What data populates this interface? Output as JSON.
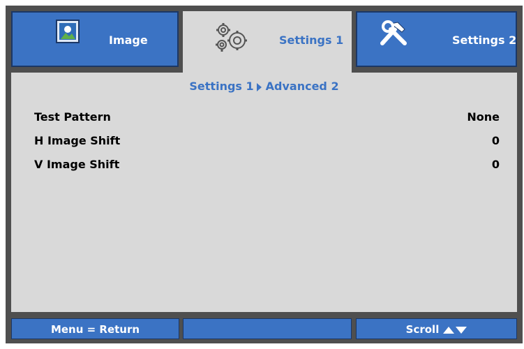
{
  "tabs": [
    {
      "label": "Image",
      "icon": "image-icon",
      "active": false
    },
    {
      "label": "Settings 1",
      "icon": "gears-icon",
      "active": true
    },
    {
      "label": "Settings 2",
      "icon": "tools-icon",
      "active": false
    }
  ],
  "breadcrumb": {
    "parent": "Settings 1",
    "current": "Advanced 2"
  },
  "items": [
    {
      "label": "Test Pattern",
      "value": "None"
    },
    {
      "label": "H Image Shift",
      "value": "0"
    },
    {
      "label": "V Image Shift",
      "value": "0"
    }
  ],
  "footer": {
    "left": "Menu = Return",
    "middle": "",
    "right": "Scroll"
  },
  "colors": {
    "accent": "#3b73c4",
    "panel": "#d9d9d9",
    "frame": "#4f4f4f"
  }
}
